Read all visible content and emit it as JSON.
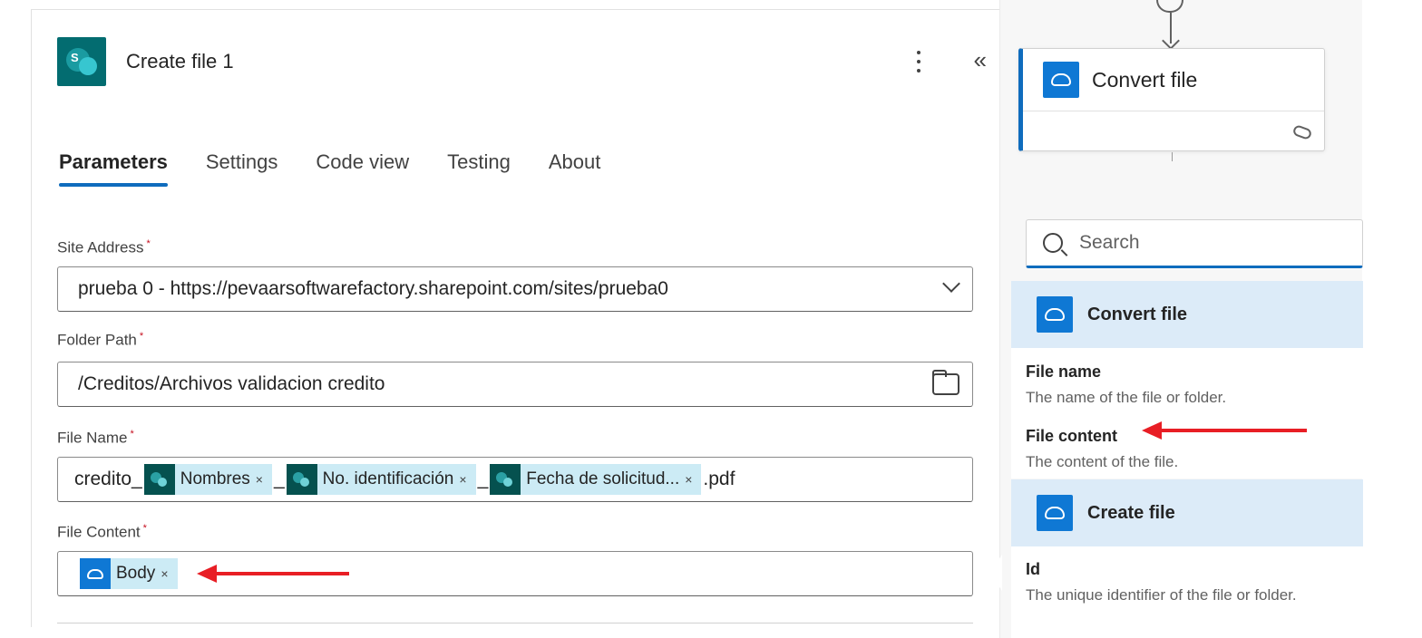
{
  "header": {
    "title": "Create file 1"
  },
  "tabs": [
    {
      "label": "Parameters",
      "active": true
    },
    {
      "label": "Settings",
      "active": false
    },
    {
      "label": "Code view",
      "active": false
    },
    {
      "label": "Testing",
      "active": false
    },
    {
      "label": "About",
      "active": false
    }
  ],
  "fields": {
    "site_address": {
      "label": "Site Address",
      "value": "prueba 0 - https://pevaarsoftwarefactory.sharepoint.com/sites/prueba0"
    },
    "folder_path": {
      "label": "Folder Path",
      "value": "/Creditos/Archivos validacion credito"
    },
    "file_name": {
      "label": "File Name",
      "prefix": "credito_",
      "tokens": [
        "Nombres",
        "No. identificación",
        "Fecha de solicitud..."
      ],
      "separator": "_",
      "suffix": ".pdf"
    },
    "file_content": {
      "label": "File Content",
      "token": "Body"
    }
  },
  "right_panel": {
    "node_title": "Convert file",
    "search_placeholder": "Search",
    "groups": [
      {
        "title": "Convert file",
        "items": [
          {
            "name": "File name",
            "description": "The name of the file or folder."
          },
          {
            "name": "File content",
            "description": "The content of the file."
          }
        ]
      },
      {
        "title": "Create file",
        "items": [
          {
            "name": "Id",
            "description": "The unique identifier of the file or folder."
          }
        ]
      }
    ]
  },
  "colors": {
    "accent": "#0f6cbd",
    "sharepoint": "#036c70",
    "token_bg": "#ccebf5",
    "arrow": "#e81e25",
    "group_bg": "#dcebf8"
  },
  "icons": [
    "sharepoint-icon",
    "more-icon",
    "collapse-icon",
    "chevron-down-icon",
    "folder-icon",
    "search-icon",
    "cloud-icon",
    "link-icon"
  ]
}
